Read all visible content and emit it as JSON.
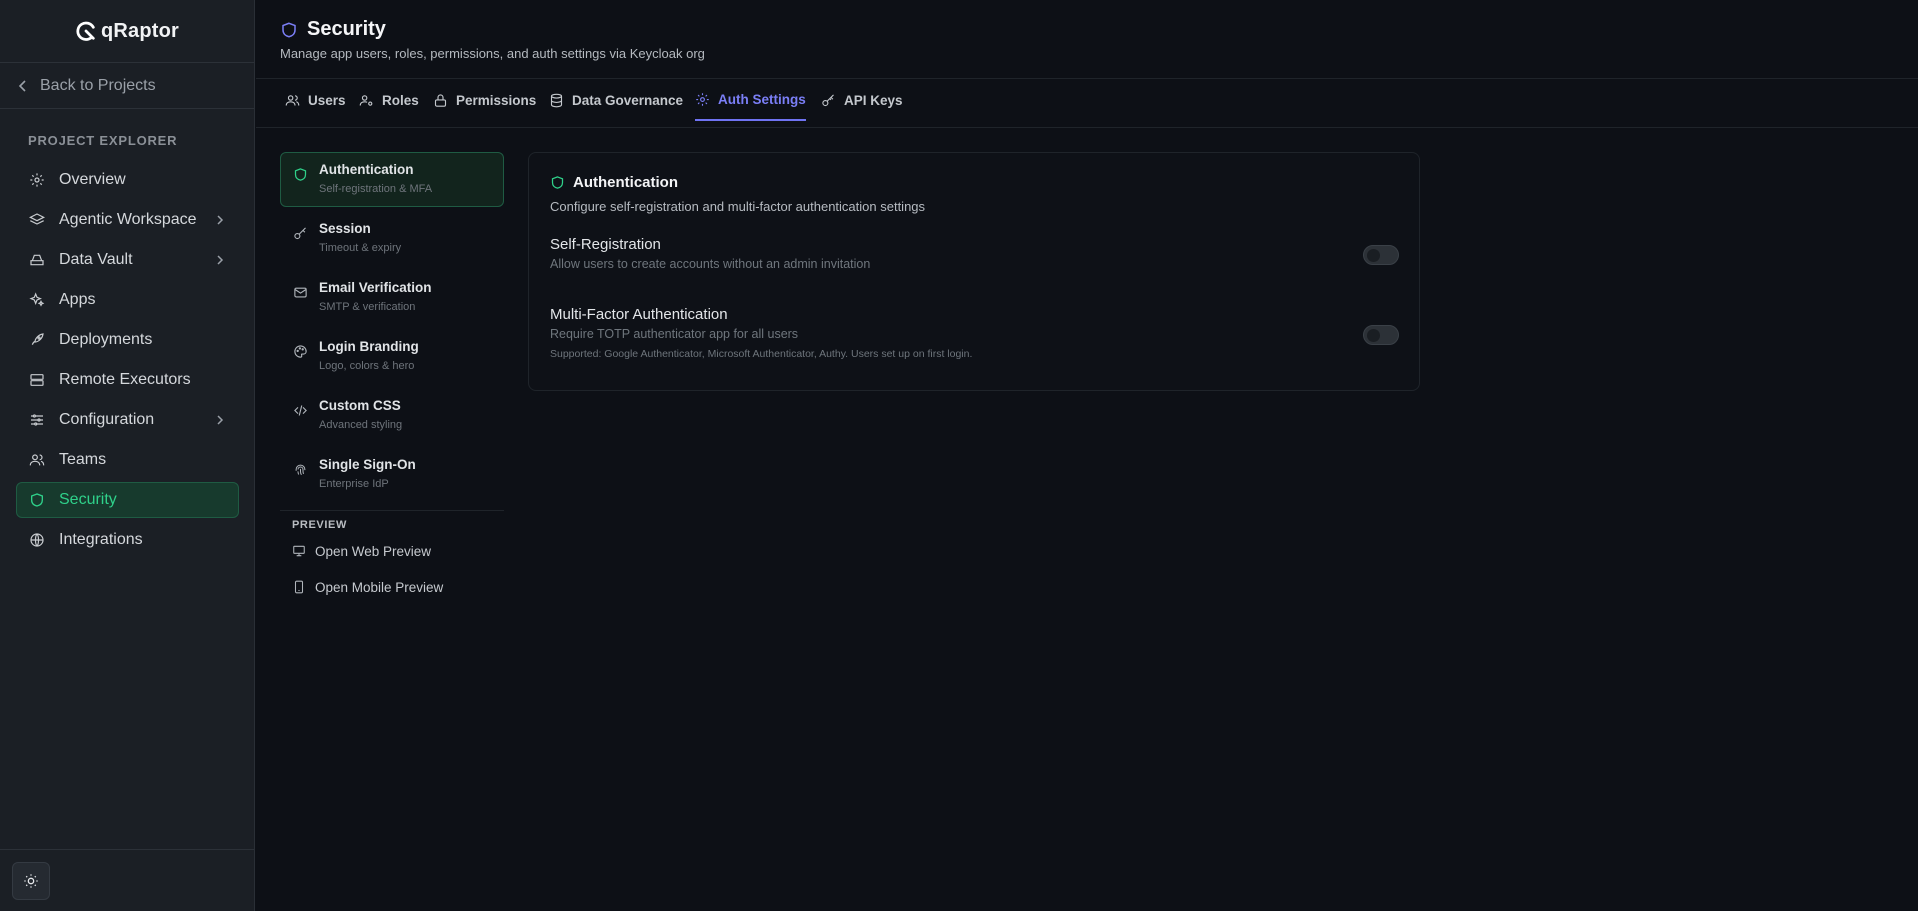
{
  "brand": {
    "name": "qRaptor"
  },
  "sidebar": {
    "back_label": "Back to Projects",
    "section_label": "PROJECT EXPLORER",
    "items": [
      {
        "label": "Overview",
        "icon": "gear-icon",
        "expandable": false,
        "active": false
      },
      {
        "label": "Agentic Workspace",
        "icon": "layers-icon",
        "expandable": true,
        "active": false
      },
      {
        "label": "Data Vault",
        "icon": "drive-icon",
        "expandable": true,
        "active": false
      },
      {
        "label": "Apps",
        "icon": "sparkles-icon",
        "expandable": false,
        "active": false
      },
      {
        "label": "Deployments",
        "icon": "rocket-icon",
        "expandable": false,
        "active": false
      },
      {
        "label": "Remote Executors",
        "icon": "server-icon",
        "expandable": false,
        "active": false
      },
      {
        "label": "Configuration",
        "icon": "sliders-icon",
        "expandable": true,
        "active": false
      },
      {
        "label": "Teams",
        "icon": "users-icon",
        "expandable": false,
        "active": false
      },
      {
        "label": "Security",
        "icon": "shield-icon",
        "expandable": false,
        "active": true
      },
      {
        "label": "Integrations",
        "icon": "globe-icon",
        "expandable": false,
        "active": false
      }
    ],
    "theme_toggle_icon": "sun-icon"
  },
  "header": {
    "title": "Security",
    "subtitle": "Manage app users, roles, permissions, and auth settings via Keycloak org"
  },
  "tabs": [
    {
      "label": "Users",
      "icon": "users-icon",
      "active": false
    },
    {
      "label": "Roles",
      "icon": "user-cog-icon",
      "active": false
    },
    {
      "label": "Permissions",
      "icon": "lock-icon",
      "active": false
    },
    {
      "label": "Data Governance",
      "icon": "database-icon",
      "active": false
    },
    {
      "label": "Auth Settings",
      "icon": "gear-icon",
      "active": true
    },
    {
      "label": "API Keys",
      "icon": "key-icon",
      "active": false
    }
  ],
  "subnav": {
    "items": [
      {
        "label": "Authentication",
        "desc": "Self-registration & MFA",
        "icon": "shield-icon",
        "active": true
      },
      {
        "label": "Session",
        "desc": "Timeout & expiry",
        "icon": "key-icon",
        "active": false
      },
      {
        "label": "Email Verification",
        "desc": "SMTP & verification",
        "icon": "mail-icon",
        "active": false
      },
      {
        "label": "Login Branding",
        "desc": "Logo, colors & hero",
        "icon": "palette-icon",
        "active": false
      },
      {
        "label": "Custom CSS",
        "desc": "Advanced styling",
        "icon": "code-icon",
        "active": false
      },
      {
        "label": "Single Sign-On",
        "desc": "Enterprise IdP",
        "icon": "fingerprint-icon",
        "active": false
      }
    ],
    "preview_label": "PREVIEW",
    "preview_items": [
      {
        "label": "Open Web Preview",
        "icon": "monitor-icon"
      },
      {
        "label": "Open Mobile Preview",
        "icon": "smartphone-icon"
      }
    ]
  },
  "card": {
    "title": "Authentication",
    "description": "Configure self-registration and multi-factor authentication settings",
    "settings": [
      {
        "title": "Self-Registration",
        "description": "Allow users to create accounts without an admin invitation",
        "note": "",
        "enabled": false
      },
      {
        "title": "Multi-Factor Authentication",
        "description": "Require TOTP authenticator app for all users",
        "note": "Supported: Google Authenticator, Microsoft Authenticator, Authy. Users set up on first login.",
        "enabled": false
      }
    ]
  },
  "colors": {
    "accent_green": "#2fd18a",
    "accent_purple": "#7b7ff7",
    "background": "#0d1016",
    "sidebar": "#1b1f25"
  }
}
